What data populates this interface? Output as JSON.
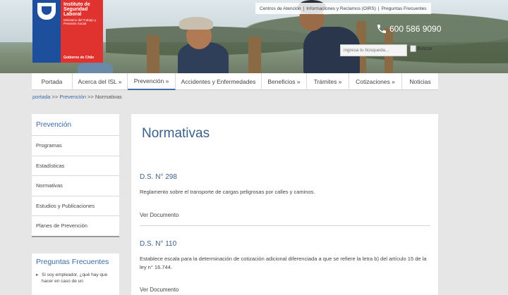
{
  "logo": {
    "name_line1": "Instituto de",
    "name_line2": "Seguridad",
    "name_line3": "Laboral",
    "ministry": "Ministerio del Trabajo y Previsión Social",
    "government": "Gobierno de Chile"
  },
  "top_links": [
    "Centros de Atención",
    "Informaciones y Reclamos (OIRS)",
    "Preguntas Frecuentes"
  ],
  "phone": "600 586 9090",
  "search": {
    "placeholder": "ingresa tu búsqueda...",
    "button_label": "Buscar"
  },
  "nav": [
    "Portada",
    "Acerca del ISL »",
    "Prevención »",
    "Accidentes y Enfermedades",
    "Beneficios »",
    "Trámites »",
    "Cotizaciones »",
    "Noticias"
  ],
  "nav_active": "Prevención »",
  "breadcrumb": {
    "home": "portada",
    "sep": ">>",
    "section": "Prevención",
    "current": "Normativas"
  },
  "sidebar": {
    "title": "Prevención",
    "items": [
      "Programas",
      "Estadísticas",
      "Normativas",
      "Estudios y Publicaciones",
      "Planes de Prevención"
    ]
  },
  "faq": {
    "title": "Preguntas Frecuentes",
    "first_question": "Si soy empleador, ¿qué hay que hacer en caso de un"
  },
  "main": {
    "title": "Normativas",
    "entries": [
      {
        "title": "D.S. N° 298",
        "description": "Reglamento sobre el transporte de cargas peligrosas por calles y caminos.",
        "link": "Ver Documento"
      },
      {
        "title": "D.S. N° 110",
        "description": "Establece escala para la determinación de cotización adicional diferenciada a que se refiere la letra b) del artículo 15 de la ley n° 16.744.",
        "link": "Ver Documento"
      }
    ]
  },
  "colors": {
    "brand_blue": "#1d4f9c",
    "brand_red": "#e0322f",
    "link": "#3a6aa8",
    "heading": "#3b5f88"
  }
}
